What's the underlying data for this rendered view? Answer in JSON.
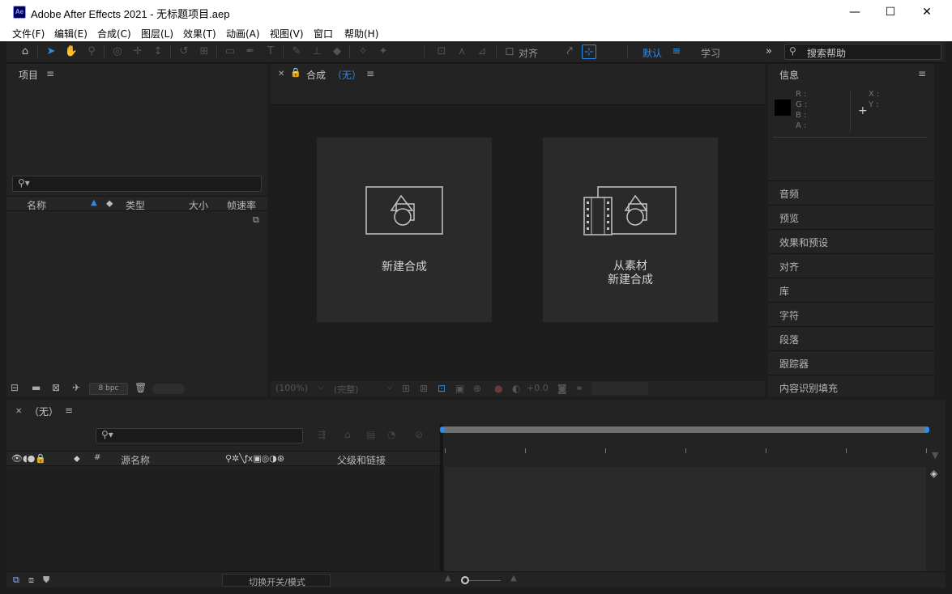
{
  "window": {
    "app_icon": "Ae",
    "title": "Adobe After Effects 2021 - 无标题项目.aep",
    "minimize": "—",
    "maximize": "☐",
    "close": "✕"
  },
  "menu": [
    "文件(F)",
    "编辑(E)",
    "合成(C)",
    "图层(L)",
    "效果(T)",
    "动画(A)",
    "视图(V)",
    "窗口",
    "帮助(H)"
  ],
  "toolbar": {
    "align_label": "对齐",
    "workspace_default": "默认",
    "workspace_learn": "学习",
    "help_placeholder": "搜索帮助"
  },
  "project_panel": {
    "title": "项目",
    "columns": [
      "名称",
      "类型",
      "大小",
      "帧速率"
    ],
    "bpc": "8 bpc"
  },
  "comp_panel": {
    "title": "合成",
    "title_none": "（无）",
    "new_comp_label": "新建合成",
    "from_footage_line1": "从素材",
    "from_footage_line2": "新建合成",
    "zoom": "(100%)",
    "quality": "(完整)",
    "exposure": "+0.0"
  },
  "info_panel": {
    "title": "信息",
    "r": "R :",
    "g": "G :",
    "b": "B :",
    "a": "A :",
    "x": "X :",
    "y": "Y :"
  },
  "side_panels": [
    "音频",
    "预览",
    "效果和预设",
    "对齐",
    "库",
    "字符",
    "段落",
    "跟踪器",
    "内容识别填充"
  ],
  "timeline": {
    "tab_label": "（无）",
    "col_source": "源名称",
    "col_num": "#",
    "col_parent": "父级和链接",
    "switch_toggle": "切换开关/模式"
  },
  "colors": {
    "accent": "#2d8ceb",
    "panel": "#232323",
    "background": "#1d1d1d"
  }
}
